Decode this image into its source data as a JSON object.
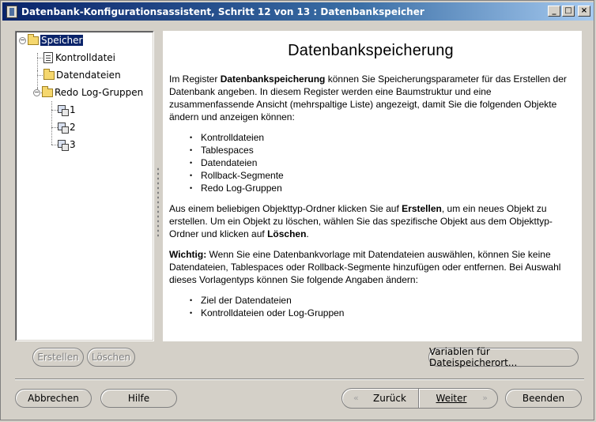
{
  "window": {
    "title": "Datenbank-Konfigurationsassistent, Schritt 12 von 13 : Datenbankspeicher"
  },
  "titlebar": {
    "minimize": "_",
    "maximize": "□",
    "close": "×"
  },
  "tree": {
    "root": "Speicher",
    "items": [
      "Kontrolldatei",
      "Datendateien",
      "Redo Log-Gruppen"
    ],
    "log_groups": [
      "1",
      "2",
      "3"
    ]
  },
  "content": {
    "heading": "Datenbankspeicherung",
    "p1_a": "Im Register ",
    "p1_b": "Datenbankspeicherung",
    "p1_c": " können Sie Speicherungsparameter für das Erstellen der Datenbank angeben. In diesem Register werden eine Baumstruktur und eine zusammenfassende Ansicht (mehrspaltige Liste) angezeigt, damit Sie die folgenden Objekte ändern und anzeigen können:",
    "list1": [
      "Kontrolldateien",
      "Tablespaces",
      "Datendateien",
      "Rollback-Segmente",
      "Redo Log-Gruppen"
    ],
    "p2_a": "Aus einem beliebigen Objekttyp-Ordner klicken Sie auf ",
    "p2_b": "Erstellen",
    "p2_c": ", um ein neues Objekt zu erstellen. Um ein Objekt zu löschen, wählen Sie das spezifische Objekt aus dem Objekttyp-Ordner und klicken auf ",
    "p2_d": "Löschen",
    "p2_e": ".",
    "p3_a": "Wichtig:",
    "p3_b": " Wenn Sie eine Datenbankvorlage mit Datendateien auswählen, können Sie keine Datendateien, Tablespaces oder Rollback-Segmente hinzufügen oder entfernen. Bei Auswahl dieses Vorlagentyps können Sie folgende Angaben ändern:",
    "list2": [
      "Ziel der Datendateien",
      "Kontrolldateien oder Log-Gruppen"
    ]
  },
  "buttons": {
    "create": "Erstellen",
    "delete": "Löschen",
    "file_vars": "Variablen für Dateispeicherort...",
    "cancel": "Abbrechen",
    "help": "Hilfe",
    "back": "Zurück",
    "next": "Weiter",
    "finish": "Beenden"
  }
}
